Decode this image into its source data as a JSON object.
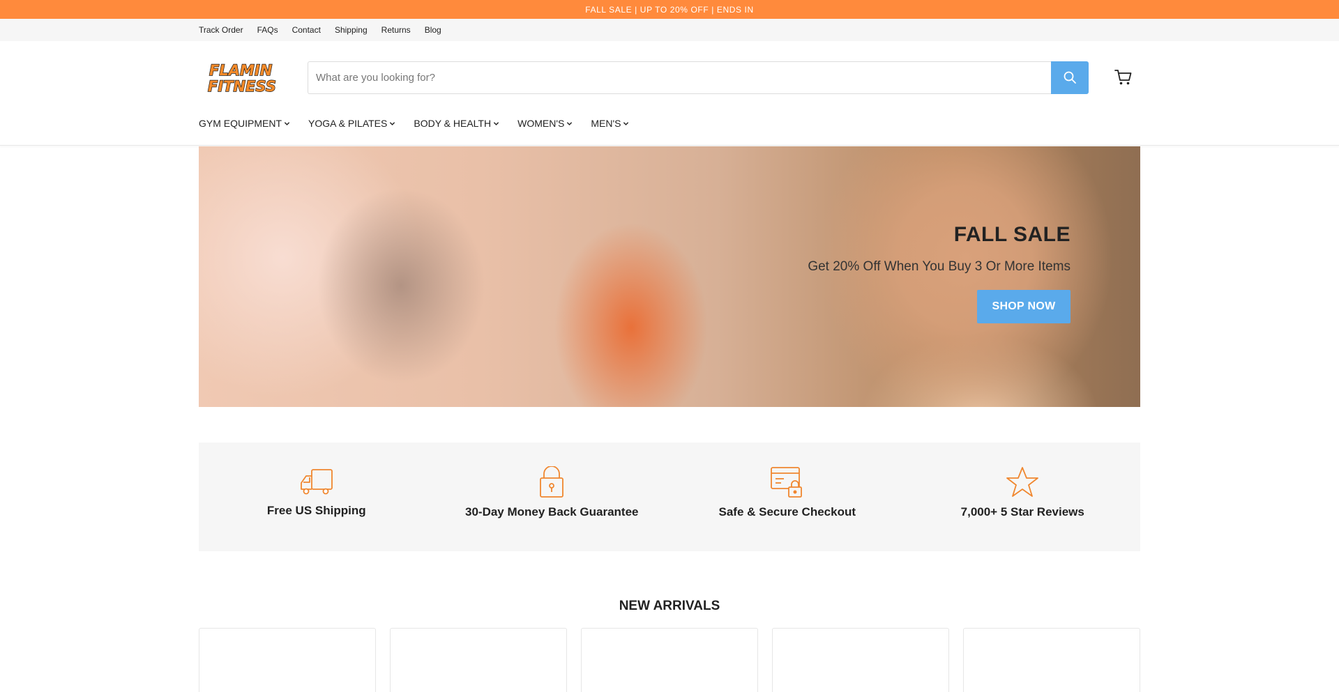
{
  "announcement": {
    "text": "FALL SALE | UP TO 20% OFF | ENDS IN"
  },
  "utility_nav": {
    "items": [
      {
        "label": "Track Order"
      },
      {
        "label": "FAQs"
      },
      {
        "label": "Contact"
      },
      {
        "label": "Shipping"
      },
      {
        "label": "Returns"
      },
      {
        "label": "Blog"
      }
    ]
  },
  "header": {
    "logo": {
      "line1": "FLAMIN",
      "line2": "FITNESS",
      "fill": "#f58b2a",
      "outline": "#1a1a1a"
    },
    "search": {
      "placeholder": "What are you looking for?",
      "button_color": "#5aaaeb",
      "icon": "search-icon"
    },
    "cart": {
      "icon": "cart-icon"
    }
  },
  "main_nav": {
    "items": [
      {
        "label": "GYM EQUIPMENT"
      },
      {
        "label": "YOGA & PILATES"
      },
      {
        "label": "BODY & HEALTH"
      },
      {
        "label": "WOMEN'S"
      },
      {
        "label": "MEN'S"
      }
    ]
  },
  "hero": {
    "title": "FALL SALE",
    "subtitle": "Get 20% Off When You Buy 3 Or More Items",
    "cta_label": "SHOP NOW",
    "cta_color": "#5aaaeb"
  },
  "features": {
    "accent_color": "#f0872f",
    "items": [
      {
        "label": "Free US Shipping",
        "icon": "truck-icon"
      },
      {
        "label": "30-Day Money Back Guarantee",
        "icon": "lock-icon"
      },
      {
        "label": "Safe & Secure Checkout",
        "icon": "secure-card-icon"
      },
      {
        "label": "7,000+ 5 Star Reviews",
        "icon": "star-icon"
      }
    ]
  },
  "new_arrivals": {
    "title": "NEW ARRIVALS"
  },
  "colors": {
    "announcement_bg": "#ff8a3c",
    "primary_button": "#5aaaeb",
    "utility_bg": "#f6f6f6"
  }
}
